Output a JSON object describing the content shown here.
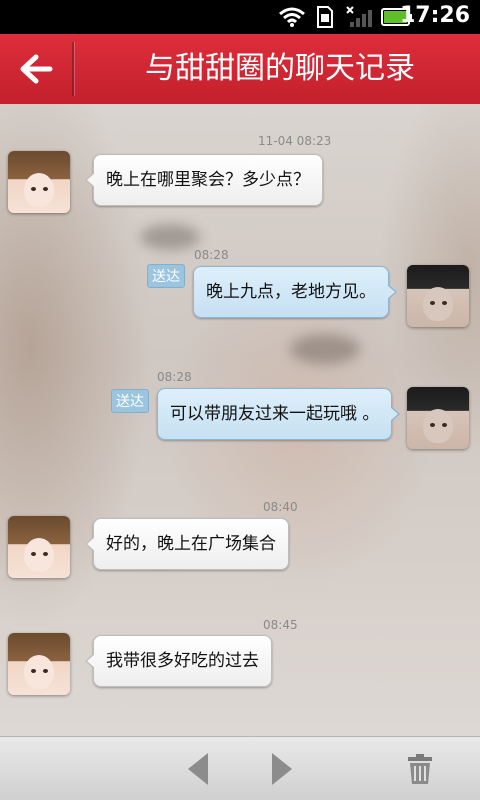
{
  "status_bar": {
    "time": "17:26"
  },
  "header": {
    "title": "与甜甜圈的聊天记录"
  },
  "messages": [
    {
      "side": "in",
      "time": "11-04  08:23",
      "text": "晚上在哪里聚会？多少点？"
    },
    {
      "side": "out",
      "time": "08:28",
      "tag": "送达",
      "text": "晚上九点，老地方见。"
    },
    {
      "side": "out",
      "time": "08:28",
      "tag": "送达",
      "text": "可以带朋友过来一起玩哦 。"
    },
    {
      "side": "in",
      "time": "08:40",
      "text": "好的，晚上在广场集合"
    },
    {
      "side": "in",
      "time": "08:45",
      "text": "我带很多好吃的过去"
    }
  ],
  "icons": {
    "back": "arrow-left-icon",
    "prev": "triangle-left-icon",
    "next": "triangle-right-icon",
    "delete": "trash-icon"
  },
  "colors": {
    "header": "#d22734",
    "outgoing_bubble": "#cfe6f6",
    "incoming_bubble": "#ffffff",
    "sent_tag": "#9bc4df"
  }
}
